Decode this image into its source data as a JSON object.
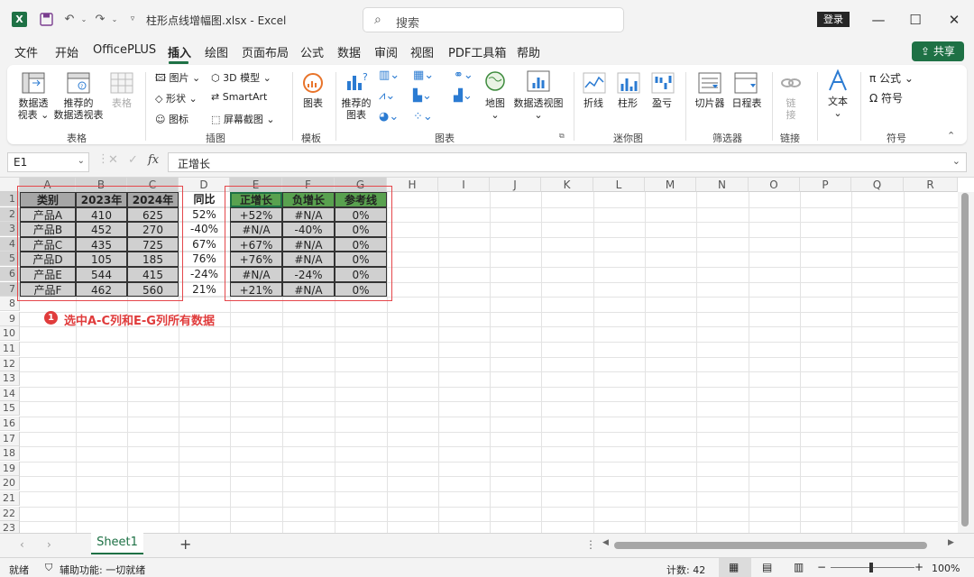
{
  "titlebar": {
    "file_name": "柱形点线增幅图.xlsx  -  Excel",
    "search_placeholder": "搜索",
    "login": "登录"
  },
  "menu": {
    "items": [
      "文件",
      "开始",
      "OfficePLUS",
      "插入",
      "绘图",
      "页面布局",
      "公式",
      "数据",
      "审阅",
      "视图",
      "PDF工具箱",
      "帮助"
    ],
    "active": "插入",
    "share": "共享"
  },
  "ribbon": {
    "groups": {
      "tables": "表格",
      "illustrations": "插图",
      "templates": "模板",
      "charts": "图表",
      "sparklines": "迷你图",
      "filters": "筛选器",
      "links": "链接",
      "symbols": "符号"
    },
    "pivot_table": [
      "数据透",
      "视表"
    ],
    "recommended_pivot": [
      "推荐的",
      "数据透视表"
    ],
    "table": "表格",
    "pictures": "图片",
    "shapes": "形状",
    "icons": "图标",
    "models_3d": "3D 模型",
    "smartart": "SmartArt",
    "screenshot": "屏幕截图",
    "chart_template": "图表",
    "recommended_charts": [
      "推荐的",
      "图表"
    ],
    "maps": "地图",
    "pivot_chart": "数据透视图",
    "line": "折线",
    "column": "柱形",
    "win_loss": "盈亏",
    "slicer": "切片器",
    "timeline": "日程表",
    "link": [
      "链",
      "接"
    ],
    "text": "文本",
    "equation": "公式",
    "symbol": "符号"
  },
  "formula_bar": {
    "name_box": "E1",
    "fx": "fx",
    "formula": "正增长"
  },
  "columns": [
    "A",
    "B",
    "C",
    "D",
    "E",
    "F",
    "G",
    "H",
    "I",
    "J",
    "K",
    "L",
    "M",
    "N",
    "O",
    "P",
    "Q",
    "R"
  ],
  "rows": [
    "1",
    "2",
    "3",
    "4",
    "5",
    "6",
    "7",
    "8",
    "9",
    "10",
    "11",
    "12",
    "13",
    "14",
    "15",
    "16",
    "17",
    "18",
    "19",
    "20",
    "21",
    "22",
    "23"
  ],
  "table": {
    "headers": [
      "类别",
      "2023年",
      "2024年",
      "同比",
      "正增长",
      "负增长",
      "参考线"
    ],
    "data": [
      [
        "产品A",
        "410",
        "625",
        "52%",
        "+52%",
        "#N/A",
        "0%"
      ],
      [
        "产品B",
        "452",
        "270",
        "-40%",
        "#N/A",
        "-40%",
        "0%"
      ],
      [
        "产品C",
        "435",
        "725",
        "67%",
        "+67%",
        "#N/A",
        "0%"
      ],
      [
        "产品D",
        "105",
        "185",
        "76%",
        "+76%",
        "#N/A",
        "0%"
      ],
      [
        "产品E",
        "544",
        "415",
        "-24%",
        "#N/A",
        "-24%",
        "0%"
      ],
      [
        "产品F",
        "462",
        "560",
        "21%",
        "+21%",
        "#N/A",
        "0%"
      ]
    ]
  },
  "annotation": {
    "number": "1",
    "text": "选中A-C列和E-G列所有数据"
  },
  "sheet": {
    "tab": "Sheet1",
    "add": "+"
  },
  "status": {
    "ready": "就绪",
    "accessibility": "辅助功能: 一切就绪",
    "count": "计数: 42",
    "zoom": "100%"
  },
  "colors": {
    "accent": "#1e7145",
    "header_gray": "#a6a6a6",
    "header_green": "#59a14f",
    "body_gray": "#d0d0d0",
    "annotation_red": "#e03c3c"
  }
}
